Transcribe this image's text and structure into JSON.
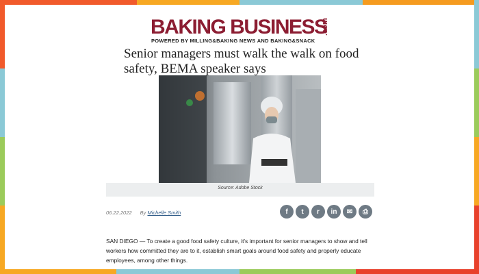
{
  "header": {
    "logo_main": "BAKING BUSINESS",
    "logo_com": ".com",
    "logo_sub": "POWERED BY MILLING&BAKING NEWS AND BAKING&SNACK"
  },
  "article": {
    "headline": "Senior managers must walk the walk on food safety, BEMA speaker says",
    "photo_caption": "Source: Adobe Stock",
    "date": "06.22.2022",
    "by_label": "By",
    "author": "Michelle Smith",
    "body": "SAN DIEGO — To create a good food safety culture, it's important for senior managers to show and tell workers how committed they are to it, establish smart goals around food safety and properly educate employees, among other things."
  },
  "share": {
    "buttons": [
      {
        "icon": "facebook-icon",
        "glyph": "f"
      },
      {
        "icon": "twitter-icon",
        "glyph": "t"
      },
      {
        "icon": "reddit-icon",
        "glyph": "r"
      },
      {
        "icon": "linkedin-icon",
        "glyph": "in"
      },
      {
        "icon": "email-icon",
        "glyph": "✉"
      },
      {
        "icon": "print-icon",
        "glyph": "⎙"
      }
    ]
  },
  "colors": {
    "brand": "#8c1d32",
    "link": "#2e5a87",
    "share_button": "#6e7a84"
  }
}
